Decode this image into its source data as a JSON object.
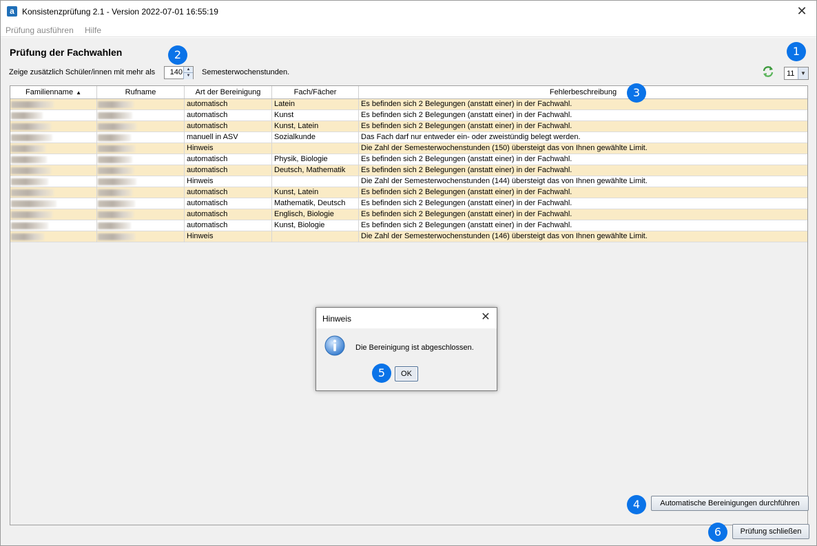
{
  "window": {
    "title": "Konsistenzprüfung 2.1 - Version 2022-07-01 16:55:19",
    "app_icon_letter": "a",
    "close_glyph": "✕"
  },
  "menu": {
    "items": [
      "Prüfung ausführen",
      "Hilfe"
    ]
  },
  "page": {
    "heading": "Prüfung der Fachwahlen",
    "option_label": "Zeige zusätzlich Schüler/innen mit mehr als",
    "hours_value": "140",
    "unit_label": "Semesterwochenstunden.",
    "size_value": "11"
  },
  "table": {
    "columns": [
      "Familienname",
      "Rufname",
      "Art der Bereinigung",
      "Fach/Fächer",
      "Fehlerbeschreibung"
    ],
    "sort_indicator": "▲",
    "rows": [
      {
        "art": "automatisch",
        "fach": "Latein",
        "fehler": "Es befinden sich 2 Belegungen (anstatt einer) in der Fachwahl."
      },
      {
        "art": "automatisch",
        "fach": "Kunst",
        "fehler": "Es befinden sich 2 Belegungen (anstatt einer) in der Fachwahl."
      },
      {
        "art": "automatisch",
        "fach": "Kunst, Latein",
        "fehler": "Es befinden sich 2 Belegungen (anstatt einer) in der Fachwahl."
      },
      {
        "art": "manuell in ASV",
        "fach": "Sozialkunde",
        "fehler": "Das Fach darf nur entweder ein- oder zweistündig belegt werden."
      },
      {
        "art": "Hinweis",
        "fach": "",
        "fehler": "Die Zahl der Semesterwochenstunden (150) übersteigt das von Ihnen gewählte Limit."
      },
      {
        "art": "automatisch",
        "fach": "Physik, Biologie",
        "fehler": "Es befinden sich 2 Belegungen (anstatt einer) in der Fachwahl."
      },
      {
        "art": "automatisch",
        "fach": "Deutsch, Mathematik",
        "fehler": "Es befinden sich 2 Belegungen (anstatt einer) in der Fachwahl."
      },
      {
        "art": "Hinweis",
        "fach": "",
        "fehler": "Die Zahl der Semesterwochenstunden (144) übersteigt das von Ihnen gewählte Limit."
      },
      {
        "art": "automatisch",
        "fach": "Kunst, Latein",
        "fehler": "Es befinden sich 2 Belegungen (anstatt einer) in der Fachwahl."
      },
      {
        "art": "automatisch",
        "fach": "Mathematik, Deutsch",
        "fehler": "Es befinden sich 2 Belegungen (anstatt einer) in der Fachwahl."
      },
      {
        "art": "automatisch",
        "fach": "Englisch, Biologie",
        "fehler": "Es befinden sich 2 Belegungen (anstatt einer) in der Fachwahl."
      },
      {
        "art": "automatisch",
        "fach": "Kunst, Biologie",
        "fehler": "Es befinden sich 2 Belegungen (anstatt einer) in der Fachwahl."
      },
      {
        "art": "Hinweis",
        "fach": "",
        "fehler": "Die Zahl der Semesterwochenstunden (146) übersteigt das von Ihnen gewählte Limit."
      }
    ]
  },
  "dialog": {
    "title": "Hinweis",
    "message": "Die Bereinigung ist abgeschlossen.",
    "ok_label": "OK"
  },
  "buttons": {
    "auto_clean": "Automatische Bereinigungen durchführen",
    "close_check": "Prüfung schließen"
  },
  "callouts": [
    "1",
    "2",
    "3",
    "4",
    "5",
    "6"
  ],
  "colors": {
    "row_highlight": "#faebc6",
    "callout": "#0a73e8",
    "refresh_icon": "#3c9a3c"
  }
}
